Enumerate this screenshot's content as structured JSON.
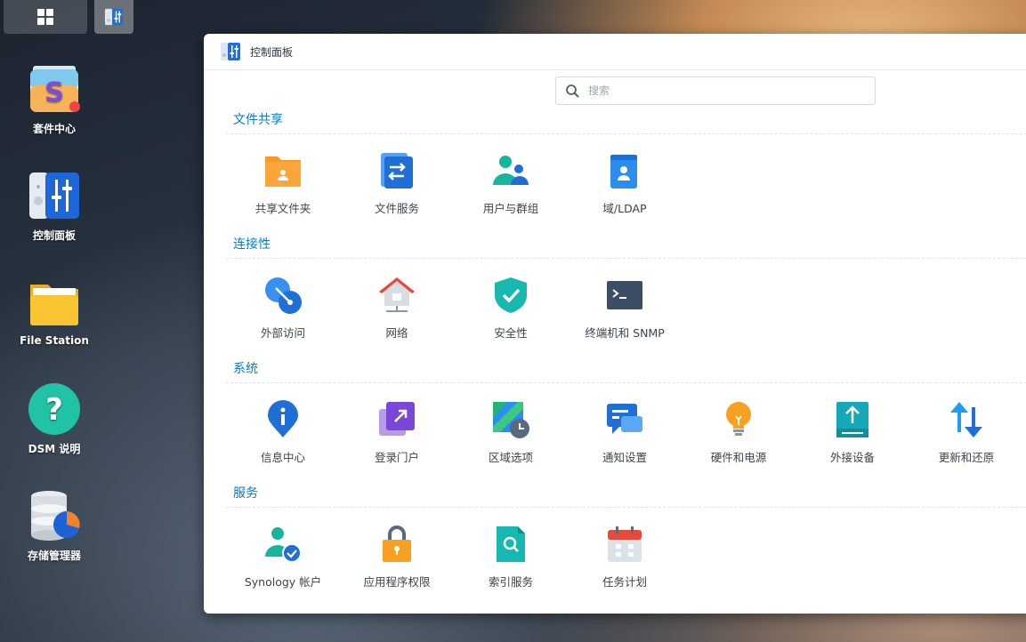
{
  "window": {
    "title": "控制面板"
  },
  "search": {
    "placeholder": "搜索"
  },
  "desktop": [
    {
      "label": "套件中心"
    },
    {
      "label": "控制面板"
    },
    {
      "label": "File Station"
    },
    {
      "label": "DSM 说明"
    },
    {
      "label": "存储管理器"
    }
  ],
  "sections": [
    {
      "title": "文件共享",
      "items": [
        {
          "label": "共享文件夹",
          "icon": "shared-folder-icon"
        },
        {
          "label": "文件服务",
          "icon": "file-services-icon"
        },
        {
          "label": "用户与群组",
          "icon": "user-group-icon"
        },
        {
          "label": "域/LDAP",
          "icon": "domain-ldap-icon"
        }
      ]
    },
    {
      "title": "连接性",
      "items": [
        {
          "label": "外部访问",
          "icon": "external-access-icon"
        },
        {
          "label": "网络",
          "icon": "network-icon"
        },
        {
          "label": "安全性",
          "icon": "security-shield-icon"
        },
        {
          "label": "终端机和 SNMP",
          "icon": "terminal-icon"
        }
      ]
    },
    {
      "title": "系统",
      "items": [
        {
          "label": "信息中心",
          "icon": "info-center-icon"
        },
        {
          "label": "登录门户",
          "icon": "login-portal-icon"
        },
        {
          "label": "区域选项",
          "icon": "regional-options-icon"
        },
        {
          "label": "通知设置",
          "icon": "notification-icon"
        },
        {
          "label": "硬件和电源",
          "icon": "hardware-power-icon"
        },
        {
          "label": "外接设备",
          "icon": "external-devices-icon"
        },
        {
          "label": "更新和还原",
          "icon": "update-restore-icon"
        }
      ]
    },
    {
      "title": "服务",
      "items": [
        {
          "label": "Synology 帐户",
          "icon": "synology-account-icon"
        },
        {
          "label": "应用程序权限",
          "icon": "application-privileges-icon"
        },
        {
          "label": "索引服务",
          "icon": "indexing-service-icon"
        },
        {
          "label": "任务计划",
          "icon": "task-scheduler-icon"
        }
      ]
    }
  ]
}
